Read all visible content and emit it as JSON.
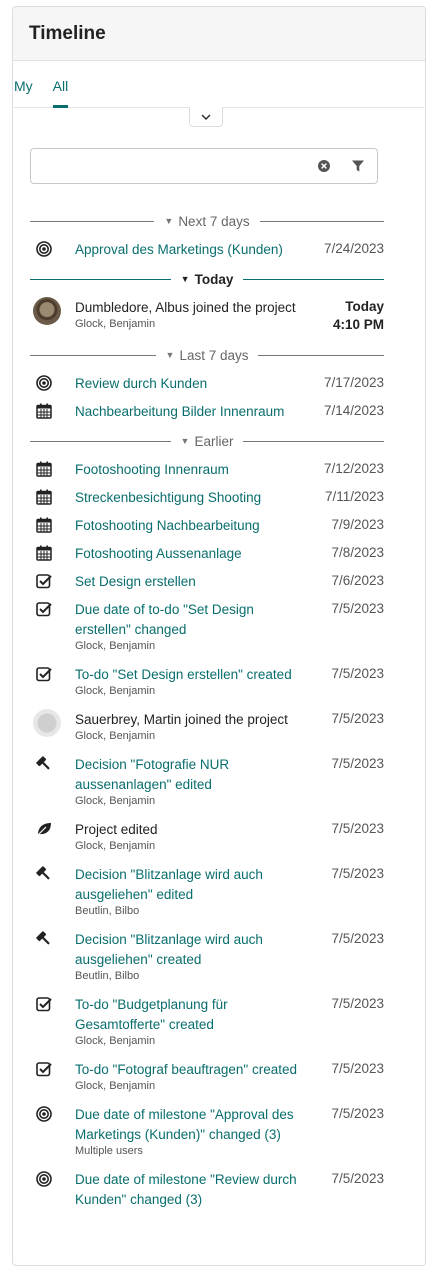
{
  "panel": {
    "title": "Timeline"
  },
  "tabs": [
    {
      "label": "My"
    },
    {
      "label": "All"
    }
  ],
  "search": {
    "value": "",
    "placeholder": ""
  },
  "groups": {
    "next7": "Next 7 days",
    "today": "Today",
    "last7": "Last 7 days",
    "earlier": "Earlier"
  },
  "entries": [
    {
      "icon": "milestone-icon",
      "title": "Approval des Marketings (Kunden)",
      "date": "7/24/2023"
    },
    {
      "icon": "avatar-photo",
      "title": "Dumbledore, Albus joined the project",
      "author": "Glock, Benjamin",
      "date_line1": "Today",
      "date_line2": "4:10 PM"
    },
    {
      "icon": "milestone-icon",
      "title": "Review durch Kunden",
      "date": "7/17/2023"
    },
    {
      "icon": "calendar-icon",
      "title": "Nachbearbeitung Bilder Innenraum",
      "date": "7/14/2023"
    },
    {
      "icon": "calendar-icon",
      "title": "Footoshooting Innenraum",
      "date": "7/12/2023"
    },
    {
      "icon": "calendar-icon",
      "title": "Streckenbesichtigung Shooting",
      "date": "7/11/2023"
    },
    {
      "icon": "calendar-icon",
      "title": "Fotoshooting Nachbearbeitung",
      "date": "7/9/2023"
    },
    {
      "icon": "calendar-icon",
      "title": "Fotoshooting Aussenanlage",
      "date": "7/8/2023"
    },
    {
      "icon": "checkbox-icon",
      "title": "Set Design erstellen",
      "date": "7/6/2023"
    },
    {
      "icon": "checkbox-icon",
      "title": "Due date of to-do \"Set Design erstellen\" changed",
      "author": "Glock, Benjamin",
      "date": "7/5/2023"
    },
    {
      "icon": "checkbox-icon",
      "title": "To-do \"Set Design erstellen\" created",
      "author": "Glock, Benjamin",
      "date": "7/5/2023"
    },
    {
      "icon": "avatar-blank",
      "title": "Sauerbrey, Martin joined the project",
      "author": "Glock, Benjamin",
      "date": "7/5/2023"
    },
    {
      "icon": "gavel-icon",
      "title": "Decision \"Fotografie NUR aussenanlagen\" edited",
      "author": "Glock, Benjamin",
      "date": "7/5/2023"
    },
    {
      "icon": "leaf-icon",
      "title": "Project edited",
      "author": "Glock, Benjamin",
      "date": "7/5/2023"
    },
    {
      "icon": "gavel-icon",
      "title": "Decision \"Blitzanlage wird auch ausgeliehen\" edited",
      "author": "Beutlin, Bilbo",
      "date": "7/5/2023"
    },
    {
      "icon": "gavel-icon",
      "title": "Decision \"Blitzanlage wird auch ausgeliehen\" created",
      "author": "Beutlin, Bilbo",
      "date": "7/5/2023"
    },
    {
      "icon": "checkbox-icon",
      "title": "To-do \"Budgetplanung für Gesamtofferte\" created",
      "author": "Glock, Benjamin",
      "date": "7/5/2023"
    },
    {
      "icon": "checkbox-icon",
      "title": "To-do \"Fotograf beauftragen\" created",
      "author": "Glock, Benjamin",
      "date": "7/5/2023"
    },
    {
      "icon": "milestone-icon",
      "title": "Due date of milestone \"Approval des Marketings (Kunden)\" changed (3)",
      "author": "Multiple users",
      "date": "7/5/2023"
    },
    {
      "icon": "milestone-icon",
      "title": "Due date of milestone \"Review durch Kunden\" changed (3)",
      "date": "7/5/2023"
    }
  ]
}
